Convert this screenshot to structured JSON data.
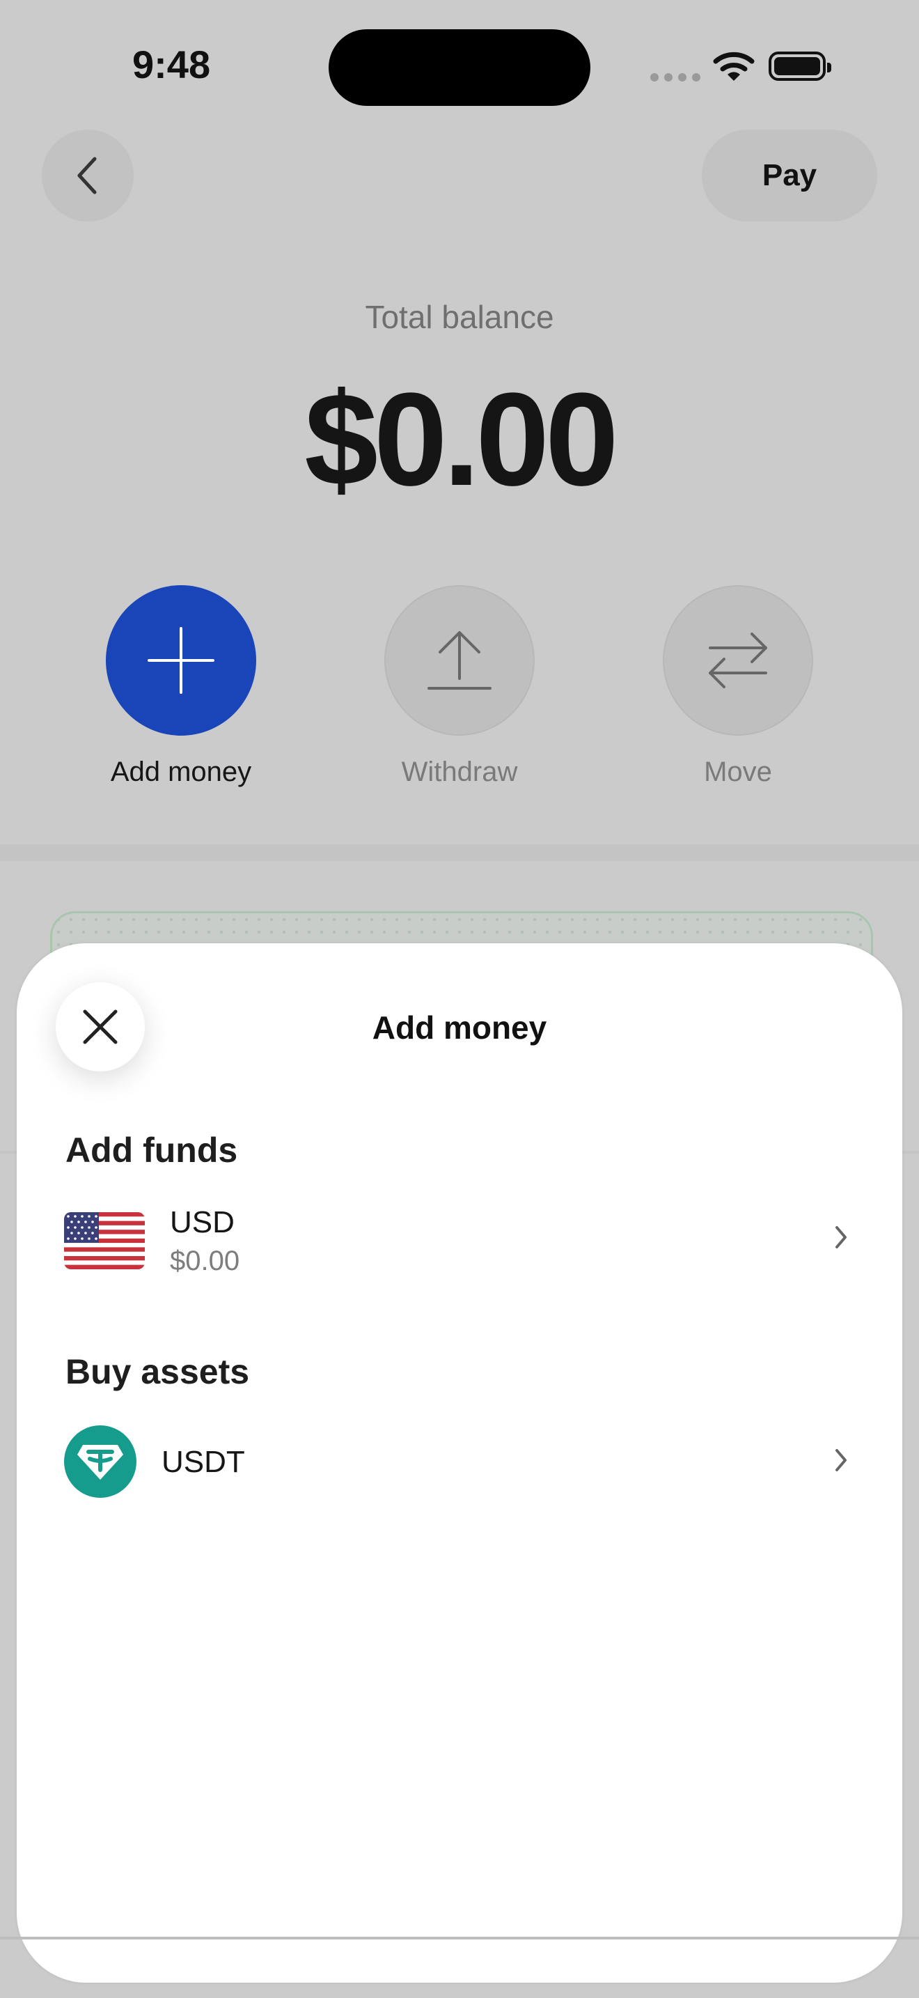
{
  "status_bar": {
    "time": "9:48"
  },
  "header": {
    "pay_label": "Pay"
  },
  "balance": {
    "label": "Total balance",
    "value": "$0.00"
  },
  "actions": [
    {
      "label": "Add money",
      "icon": "plus-icon",
      "active": true
    },
    {
      "label": "Withdraw",
      "icon": "upload-icon",
      "active": false
    },
    {
      "label": "Move",
      "icon": "transfer-arrows-icon",
      "active": false
    }
  ],
  "sheet": {
    "title": "Add money",
    "add_funds": {
      "heading": "Add funds",
      "items": [
        {
          "name": "USD",
          "balance": "$0.00",
          "icon": "us-flag-icon"
        }
      ]
    },
    "buy_assets": {
      "heading": "Buy assets",
      "items": [
        {
          "name": "USDT",
          "icon": "tether-icon"
        }
      ]
    }
  },
  "colors": {
    "accent": "#1a45b9",
    "tether": "#169c8c",
    "backdrop": "#cbcbcb"
  }
}
